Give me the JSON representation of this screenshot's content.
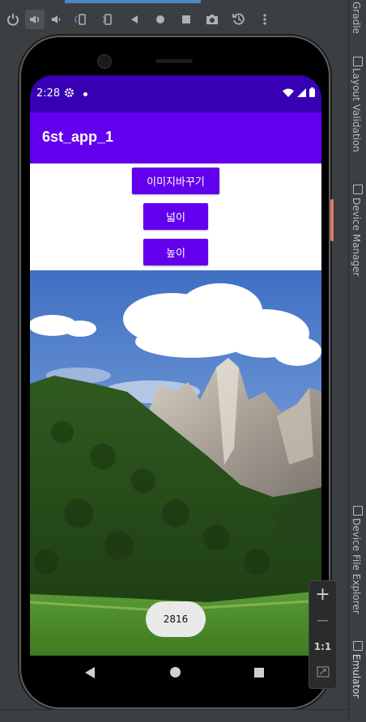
{
  "status_bar": {
    "time": "2:28"
  },
  "app_bar": {
    "title": "6st_app_1"
  },
  "buttons": {
    "change_image": "이미지바꾸기",
    "width": "넓이",
    "height": "높이"
  },
  "toast": {
    "text": "2816"
  },
  "zoom_controls": {
    "zoom_in": "+",
    "zoom_out": "−",
    "actual_size": "1:1"
  },
  "side_panel": {
    "items": [
      "Gradle",
      "Layout Validation",
      "Device Manager",
      "Device File Explorer",
      "Emulator"
    ]
  },
  "colors": {
    "primary": "#6200ee",
    "primary_dark": "#3700b3",
    "ide_background": "#3c3f41",
    "power_button": "#e07a5f"
  }
}
